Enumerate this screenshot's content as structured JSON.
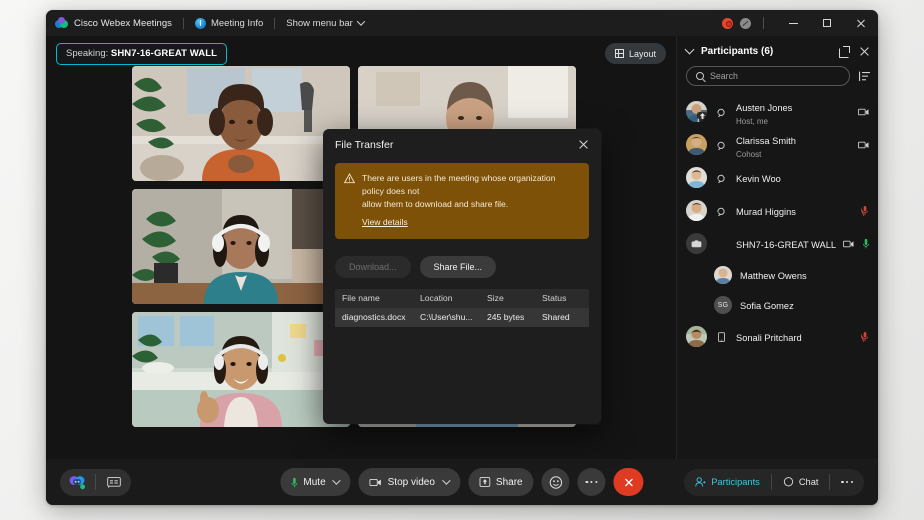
{
  "titlebar": {
    "app_name": "Cisco Webex Meetings",
    "meeting_info": "Meeting Info",
    "menu_bar": "Show menu bar",
    "recording_icon": "recording-indicator-icon",
    "network_icon": "connection-status-icon",
    "minimize": "minimize-button",
    "maximize": "maximize-button",
    "close": "close-button"
  },
  "stage": {
    "speaking_label": "Speaking:",
    "speaking_name": "SHN7-16-GREAT WALL",
    "layout_button": "Layout"
  },
  "file_transfer": {
    "title": "File Transfer",
    "warning_line1": "There are users in the meeting whose organization policy does not",
    "warning_line2": "allow them to download and share file.",
    "warning_link": "View details",
    "download_button": "Download...",
    "share_button": "Share File...",
    "columns": [
      "File name",
      "Location",
      "Size",
      "Status"
    ],
    "rows": [
      {
        "file_name": "diagnostics.docx",
        "location": "C:\\User\\shu...",
        "size": "245 bytes",
        "status": "Shared"
      }
    ]
  },
  "participants_panel": {
    "title": "Participants (6)",
    "search_placeholder": "Search",
    "search_value": "",
    "popout_icon": "pop-out-icon",
    "close_icon": "close-icon",
    "sort_icon": "sort-icon",
    "items": [
      {
        "name": "Austen Jones",
        "role": "Host, me",
        "type": "person",
        "nested": false,
        "avatar": "photo",
        "badge": "share-badge",
        "audio_icon": "headset-icon",
        "video_icon": "video-off-icon",
        "mic_icon": ""
      },
      {
        "name": "Clarissa Smith",
        "role": "Cohost",
        "type": "person",
        "nested": false,
        "avatar": "photo",
        "badge": "",
        "audio_icon": "headset-icon",
        "video_icon": "video-off-icon",
        "mic_icon": ""
      },
      {
        "name": "Kevin Woo",
        "role": "",
        "type": "person",
        "nested": false,
        "avatar": "photo",
        "badge": "",
        "audio_icon": "headset-icon",
        "video_icon": "",
        "mic_icon": ""
      },
      {
        "name": "Murad Higgins",
        "role": "",
        "type": "person",
        "nested": false,
        "avatar": "photo",
        "badge": "",
        "audio_icon": "headset-icon",
        "video_icon": "",
        "mic_icon": "mic-muted-icon"
      },
      {
        "name": "SHN7-16-GREAT WALL",
        "role": "",
        "type": "device",
        "nested": false,
        "avatar": "device",
        "badge": "",
        "audio_icon": "",
        "video_icon": "video-off-icon",
        "mic_icon": "mic-active-icon"
      },
      {
        "name": "Matthew Owens",
        "role": "",
        "type": "person",
        "nested": true,
        "avatar": "photo",
        "badge": "",
        "audio_icon": "",
        "video_icon": "",
        "mic_icon": ""
      },
      {
        "name": "Sofia Gomez",
        "role": "",
        "type": "person",
        "nested": true,
        "avatar": "initials",
        "initials": "SG",
        "badge": "",
        "audio_icon": "",
        "video_icon": "",
        "mic_icon": ""
      },
      {
        "name": "Sonali Pritchard",
        "role": "",
        "type": "person",
        "nested": false,
        "avatar": "photo",
        "badge": "",
        "audio_icon": "mobile-icon",
        "video_icon": "",
        "mic_icon": "mic-muted-icon"
      }
    ]
  },
  "toolbar": {
    "ai_assistant_icon": "webex-ai-assistant-icon",
    "captions_icon": "closed-captions-icon",
    "mute": "Mute",
    "stop_video": "Stop video",
    "share": "Share",
    "reactions_icon": "reactions-smiley-icon",
    "more_icon": "more-options-icon",
    "leave_icon": "leave-meeting-icon",
    "participants": "Participants",
    "chat": "Chat",
    "right_more_icon": "more-panels-icon"
  },
  "colors": {
    "accent_teal": "#00bbd3",
    "active_teal": "#3cc8e0",
    "warning_bg": "#7d5107",
    "leave_red": "#e03b22",
    "mic_muted_red": "#d0463a",
    "mic_active_green": "#2dbd63",
    "window_bg": "#1a1a1a",
    "panel_bg": "#161616",
    "dialog_bg": "#1e1e1e"
  }
}
